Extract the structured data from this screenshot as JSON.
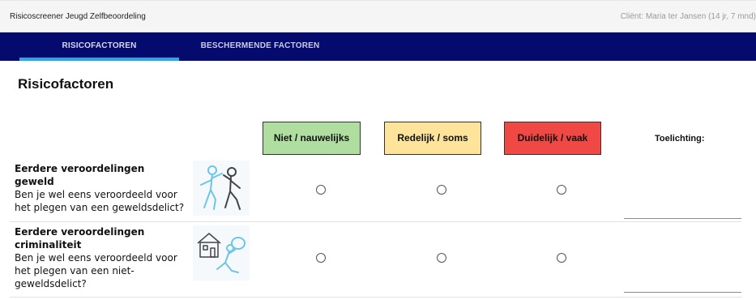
{
  "header": {
    "app_title": "Risicoscreener Jeugd Zelfbeoordeling",
    "client": "Cliënt: Maria ter Jansen (14 jr, 7 mnd)"
  },
  "nav": {
    "tabs": [
      {
        "label": "RISICOFACTOREN",
        "active": true
      },
      {
        "label": "BESCHERMENDE FACTOREN",
        "active": false
      }
    ],
    "accent": "#29a7e1",
    "background": "#050a6e"
  },
  "page": {
    "title": "Risicofactoren"
  },
  "scale": {
    "options": [
      {
        "label": "Niet / nauwelijks",
        "color": "#b0dea0"
      },
      {
        "label": "Redelijk / soms",
        "color": "#fde49a"
      },
      {
        "label": "Duidelijk / vaak",
        "color": "#f04844"
      }
    ],
    "toelichting_label": "Toelichting:"
  },
  "items": [
    {
      "title": "Eerdere veroordelingen geweld",
      "question": "Ben je wel eens veroordeeld voor het plegen van een geweldsdelict?",
      "icon": "fight-illustration-icon",
      "selected": null,
      "toelichting": ""
    },
    {
      "title": "Eerdere veroordelingen criminaliteit",
      "question": "Ben je wel eens veroordeeld voor het plegen van een niet-geweldsdelict?",
      "icon": "burglar-illustration-icon",
      "selected": null,
      "toelichting": ""
    }
  ]
}
